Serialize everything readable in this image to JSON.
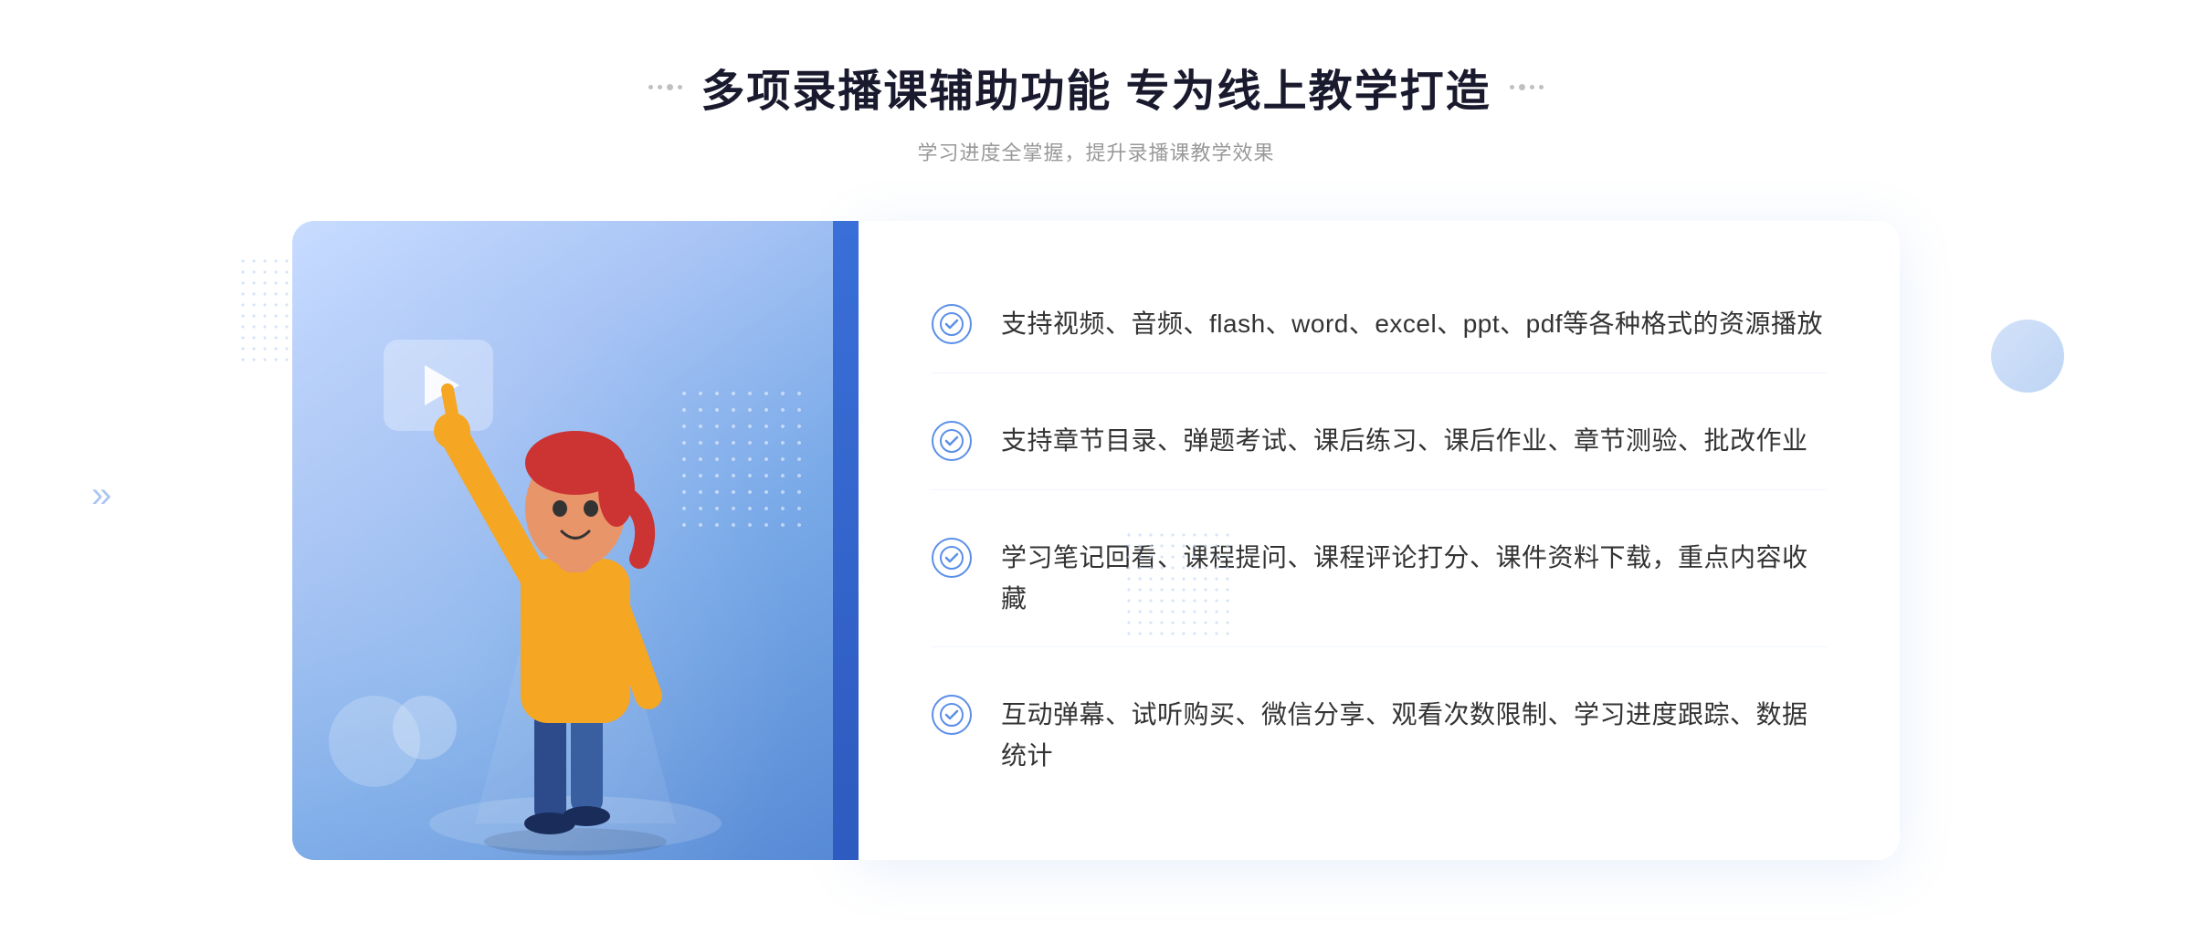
{
  "header": {
    "title": "多项录播课辅助功能 专为线上教学打造",
    "subtitle": "学习进度全掌握，提升录播课教学效果"
  },
  "features": [
    {
      "id": 1,
      "text": "支持视频、音频、flash、word、excel、ppt、pdf等各种格式的资源播放"
    },
    {
      "id": 2,
      "text": "支持章节目录、弹题考试、课后练习、课后作业、章节测验、批改作业"
    },
    {
      "id": 3,
      "text": "学习笔记回看、课程提问、课程评论打分、课件资料下载，重点内容收藏"
    },
    {
      "id": 4,
      "text": "互动弹幕、试听购买、微信分享、观看次数限制、学习进度跟踪、数据统计"
    }
  ],
  "illustration": {
    "play_button_aria": "play-button",
    "figure_aria": "teaching-figure"
  },
  "colors": {
    "accent_blue": "#5b8fe8",
    "gradient_start": "#c8dcff",
    "gradient_end": "#5588d4",
    "text_dark": "#1a1a2e",
    "text_medium": "#333333",
    "text_light": "#999999"
  }
}
